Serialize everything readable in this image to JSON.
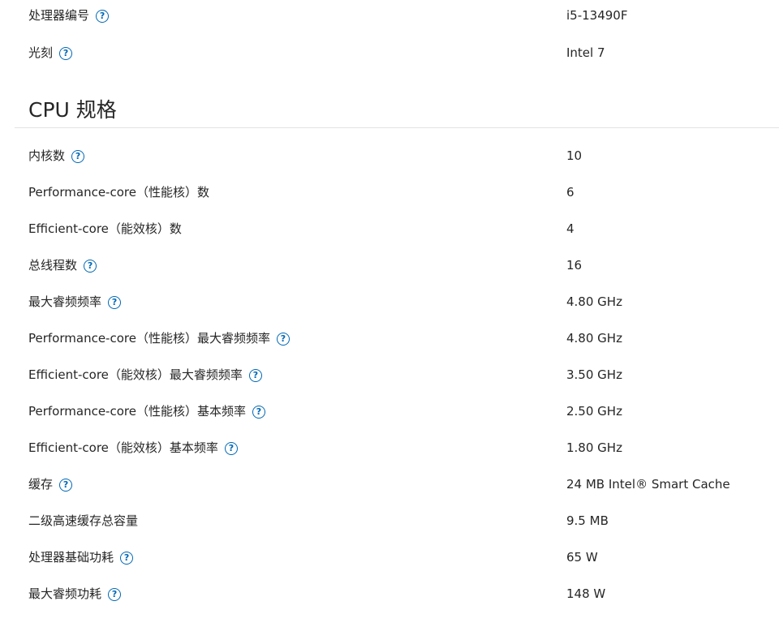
{
  "info_rows": [
    {
      "label": "处理器编号",
      "value": "i5-13490F",
      "help": true
    },
    {
      "label": "光刻",
      "value": "Intel 7",
      "help": true
    }
  ],
  "section": {
    "title": "CPU 规格"
  },
  "spec_rows": [
    {
      "label": "内核数",
      "value": "10",
      "help": true
    },
    {
      "label": "Performance-core（性能核）数",
      "value": "6",
      "help": false
    },
    {
      "label": "Efficient-core（能效核）数",
      "value": "4",
      "help": false
    },
    {
      "label": "总线程数",
      "value": "16",
      "help": true
    },
    {
      "label": "最大睿频频率",
      "value": "4.80 GHz",
      "help": true
    },
    {
      "label": "Performance-core（性能核）最大睿频频率",
      "value": "4.80 GHz",
      "help": true
    },
    {
      "label": "Efficient-core（能效核）最大睿频频率",
      "value": "3.50 GHz",
      "help": true
    },
    {
      "label": "Performance-core（性能核）基本频率",
      "value": "2.50 GHz",
      "help": true
    },
    {
      "label": "Efficient-core（能效核）基本频率",
      "value": "1.80 GHz",
      "help": true
    },
    {
      "label": "缓存",
      "value": "24 MB Intel® Smart Cache",
      "help": true
    },
    {
      "label": "二级高速缓存总容量",
      "value": "9.5 MB",
      "help": false
    },
    {
      "label": "处理器基础功耗",
      "value": "65 W",
      "help": true
    },
    {
      "label": "最大睿频功耗",
      "value": "148 W",
      "help": true
    }
  ],
  "icons": {
    "help_glyph": "?",
    "help_icon_name": "question-circle-icon",
    "accent_color": "#0068b5"
  }
}
